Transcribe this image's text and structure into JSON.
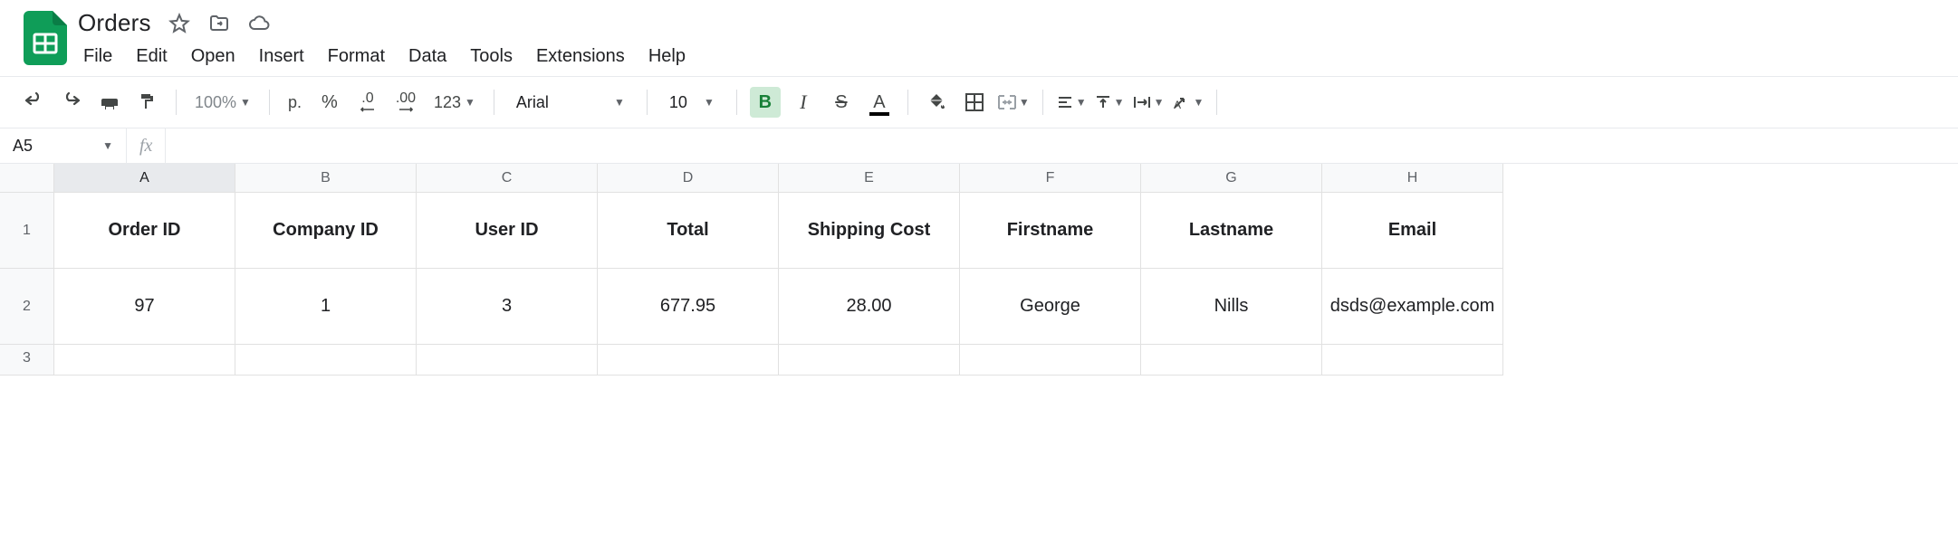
{
  "doc": {
    "title": "Orders"
  },
  "menu": {
    "file": "File",
    "edit": "Edit",
    "open": "Open",
    "insert": "Insert",
    "format": "Format",
    "data": "Data",
    "tools": "Tools",
    "extensions": "Extensions",
    "help": "Help"
  },
  "toolbar": {
    "zoom": "100%",
    "currency": "р.",
    "percent": "%",
    "dec_decrease": ".0",
    "dec_increase": ".00",
    "num_format": "123",
    "font": "Arial",
    "size": "10"
  },
  "namebox": {
    "value": "A5"
  },
  "formula": {
    "value": ""
  },
  "columns": [
    "A",
    "B",
    "C",
    "D",
    "E",
    "F",
    "G",
    "H"
  ],
  "rows": [
    "1",
    "2",
    "3"
  ],
  "headers": {
    "A": "Order ID",
    "B": "Company ID",
    "C": "User ID",
    "D": "Total",
    "E": "Shipping Cost",
    "F": "Firstname",
    "G": "Lastname",
    "H": "Email"
  },
  "data_row": {
    "A": "97",
    "B": "1",
    "C": "3",
    "D": "677.95",
    "E": "28.00",
    "F": "George",
    "G": "Nills",
    "H": "dsds@example.com"
  }
}
